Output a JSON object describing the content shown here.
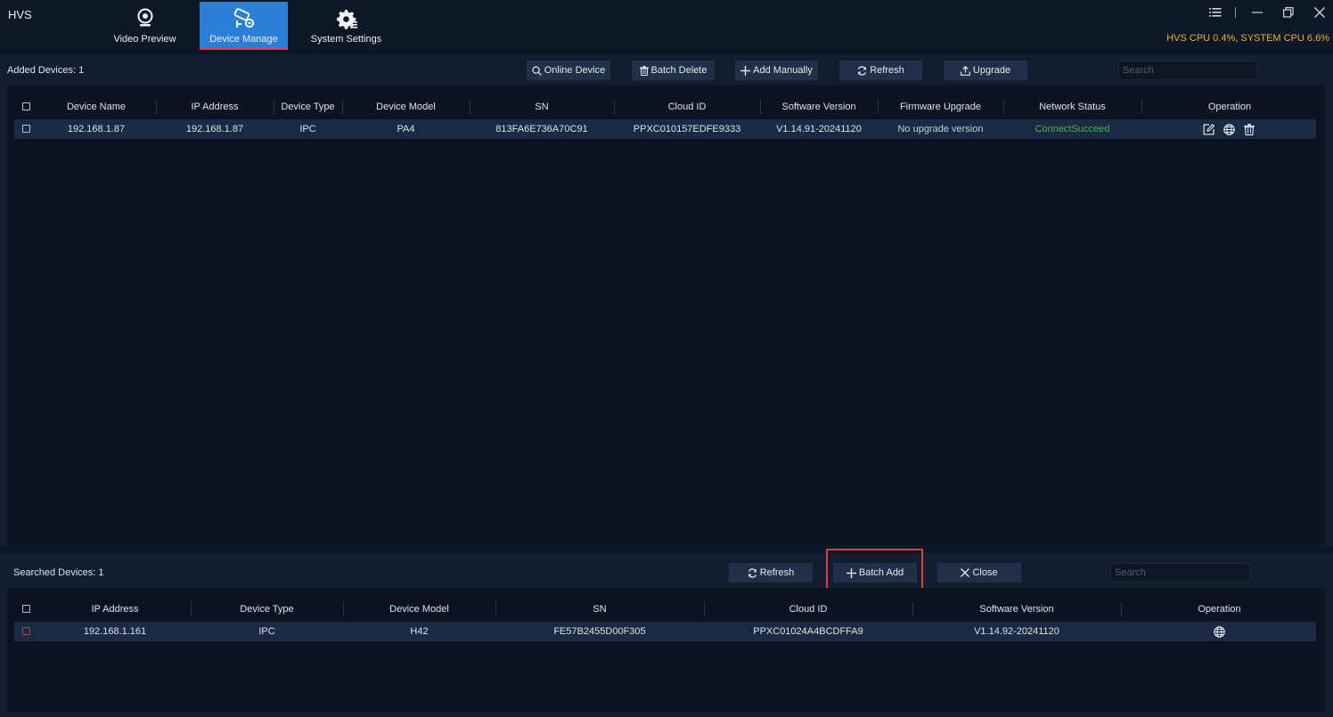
{
  "app": {
    "title": "HVS",
    "cpu_status": "HVS CPU 0.4%, SYSTEM CPU 6.6%",
    "accent_color": "#2c7fd6",
    "warning_color": "#f2ac2c"
  },
  "nav": {
    "tabs": [
      {
        "label": "Video Preview",
        "icon": "camera-icon"
      },
      {
        "label": "Device Manage",
        "icon": "device-manage-icon",
        "active": true
      },
      {
        "label": "System Settings",
        "icon": "gear-icon"
      }
    ]
  },
  "window_controls": [
    "menu-icon",
    "minimize-icon",
    "restore-icon",
    "close-icon"
  ],
  "added": {
    "label": "Added Devices: 1",
    "buttons": {
      "online_device": "Online Device",
      "batch_delete": "Batch Delete",
      "add_manually": "Add Manually",
      "refresh": "Refresh",
      "upgrade": "Upgrade"
    },
    "search_placeholder": "Search",
    "columns": [
      "Device Name",
      "IP Address",
      "Device Type",
      "Device Model",
      "SN",
      "Cloud ID",
      "Software Version",
      "Firmware Upgrade",
      "Network Status",
      "Operation"
    ],
    "rows": [
      {
        "device_name": "192.168.1.87",
        "ip": "192.168.1.87",
        "type": "IPC",
        "model": "PA4",
        "sn": "813FA6E736A70C91",
        "cloud_id": "PPXC010157EDFE9333",
        "software_version": "V1.14.91-20241120",
        "firmware_upgrade": "No upgrade version",
        "network_status": "ConnectSucceed",
        "network_status_color": "#3bb54a",
        "operations": [
          "edit-icon",
          "globe-icon",
          "trash-icon"
        ]
      }
    ]
  },
  "searched": {
    "label": "Searched Devices: 1",
    "buttons": {
      "refresh": "Refresh",
      "batch_add": "Batch Add",
      "close": "Close"
    },
    "search_placeholder": "Search",
    "columns": [
      "IP Address",
      "Device Type",
      "Device Model",
      "SN",
      "Cloud ID",
      "Software Version",
      "Operation"
    ],
    "rows": [
      {
        "ip": "192.168.1.161",
        "type": "IPC",
        "model": "H42",
        "sn": "FE57B2455D00F305",
        "cloud_id": "PPXC01024A4BCDFFA9",
        "software_version": "V1.14.92-20241120",
        "operations": [
          "globe-icon"
        ]
      }
    ]
  }
}
